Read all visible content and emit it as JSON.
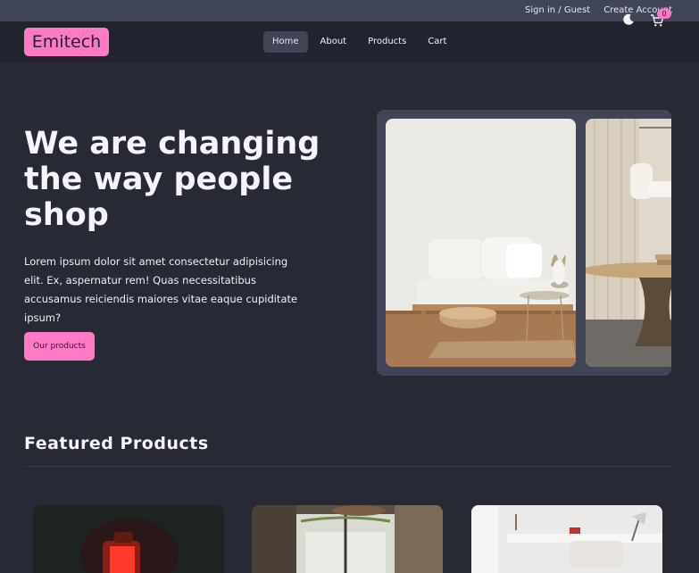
{
  "topbar": {
    "signin_label": "Sign in / Guest",
    "create_account_label": "Create Account"
  },
  "brand": {
    "logo_text": "Emitech",
    "accent_color": "#ff7ac6"
  },
  "nav": {
    "items": [
      {
        "label": "Home"
      },
      {
        "label": "About"
      },
      {
        "label": "Products"
      },
      {
        "label": "Cart"
      }
    ]
  },
  "cart": {
    "count": "0",
    "icon": "cart-icon"
  },
  "theme_toggle": {
    "icon": "moon-icon"
  },
  "hero": {
    "title": "We are changing the way people shop",
    "description": "Lorem ipsum dolor sit amet consectetur adipisicing elit. Ex, aspernatur rem! Quas necessitatibus accusamus reiciendis maiores vitae eaque cupiditate ipsum?",
    "cta_label": "Our products"
  },
  "featured": {
    "title": "Featured Products"
  }
}
